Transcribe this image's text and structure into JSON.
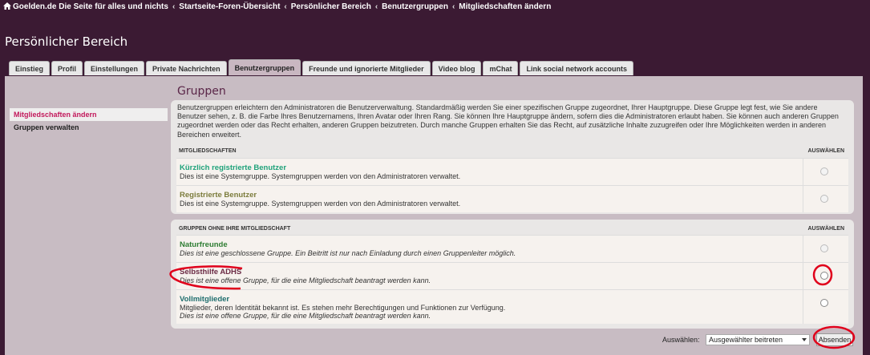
{
  "breadcrumbs": [
    "Goelden.de Die Seite für alles und nichts",
    "Startseite-Foren-Übersicht",
    "Persönlicher Bereich",
    "Benutzergruppen",
    "Mitgliedschaften ändern"
  ],
  "breadcrumb_separator": "‹",
  "page_title": "Persönlicher Bereich",
  "tabs": [
    "Einstieg",
    "Profil",
    "Einstellungen",
    "Private Nachrichten",
    "Benutzergruppen",
    "Freunde und ignorierte Mitglieder",
    "Video blog",
    "mChat",
    "Link social network accounts"
  ],
  "active_tab": "Benutzergruppen",
  "sidebar": {
    "items": [
      "Mitgliedschaften ändern",
      "Gruppen verwalten"
    ]
  },
  "heading": "Gruppen",
  "intro": "Benutzergruppen erleichtern den Administratoren die Benutzerverwaltung. Standardmäßig werden Sie einer spezifischen Gruppe zugeordnet, Ihrer Hauptgruppe. Diese Gruppe legt fest, wie Sie andere Benutzer sehen, z. B. die Farbe Ihres Benutzernamens, Ihren Avatar oder Ihren Rang. Sie können Ihre Hauptgruppe ändern, sofern dies die Administratoren erlaubt haben. Sie können auch anderen Gruppen zugeordnet werden oder das Recht erhalten, anderen Gruppen beizutreten. Durch manche Gruppen erhalten Sie das Recht, auf zusätzliche Inhalte zuzugreifen oder Ihre Möglichkeiten werden in anderen Bereichen erweitert.",
  "memberships": {
    "header": "Mitgliedschaften",
    "select_header": "Auswählen",
    "rows": [
      {
        "name": "Kürzlich registrierte Benutzer",
        "desc": "Dies ist eine Systemgruppe. Systemgruppen werden von den Administratoren verwaltet.",
        "color": "#1fa27a"
      },
      {
        "name": "Registrierte Benutzer",
        "desc": "Dies ist eine Systemgruppe. Systemgruppen werden von den Administratoren verwaltet.",
        "color": "#7c7c3c"
      }
    ]
  },
  "non_memberships": {
    "header": "Gruppen ohne Ihre Mitgliedschaft",
    "select_header": "Auswählen",
    "rows": [
      {
        "name": "Naturfreunde",
        "desc": "Dies ist eine geschlossene Gruppe. Ein Beitritt ist nur nach Einladung durch einen Gruppenleiter möglich.",
        "color": "#2e7d32"
      },
      {
        "name": "Selbsthilfe ADHS",
        "desc": "Dies ist eine offene Gruppe, für die eine Mitgliedschaft beantragt werden kann.",
        "color": "#6b2b45"
      },
      {
        "name": "Vollmitglieder",
        "desc1": "Mitglieder, deren Identität bekannt ist. Es stehen mehr Berechtigungen und Funktionen zur Verfügung.",
        "desc2": "Dies ist eine offene Gruppe, für die eine Mitgliedschaft beantragt werden kann.",
        "color": "#1f6e6e"
      }
    ]
  },
  "footer": {
    "select_label": "Auswählen:",
    "select_value": "Ausgewählter beitreten",
    "submit": "Absenden"
  },
  "colors": {
    "background": "#3b1a33",
    "panel": "#c8bcc3",
    "active_side": "#c2185b",
    "annotation": "#e0001b"
  },
  "icons": [
    "home-icon",
    "chevron-down-icon"
  ]
}
